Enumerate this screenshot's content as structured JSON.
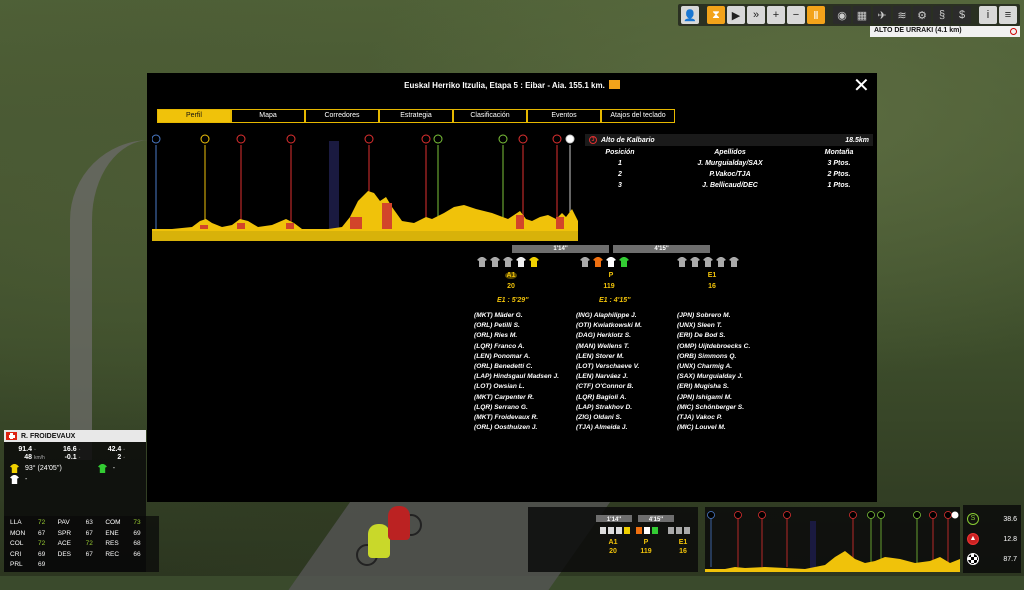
{
  "toolbar": {
    "buttons": [
      "person-icon",
      "hourglass-icon",
      "play-icon",
      "fast-forward-icon",
      "plus-icon",
      "minus-icon",
      "pause-icon",
      "eye-icon",
      "map-icon",
      "plane-icon",
      "radio-icon",
      "gear-icon",
      "strategy-icon",
      "dollar-icon",
      "info-icon",
      "menu-icon"
    ]
  },
  "climb_label": "ALTO DE URRAKI (4.1 km)",
  "modal": {
    "title": "Euskal Herriko Itzulia, Etapa 5 : Eibar - Aia. 155.1 km.",
    "tabs": [
      "Perfil",
      "Mapa",
      "Corredores",
      "Estrategia",
      "Clasificación",
      "Eventos",
      "Atajos del teclado"
    ],
    "active_tab": "Perfil"
  },
  "climb_panel": {
    "name": "Alto de Kalbario",
    "distance": "18.5km",
    "headers": [
      "Posición",
      "Apellidos",
      "Montaña"
    ],
    "rows": [
      [
        "1",
        "J. Murguialday/SAX",
        "3 Ptos."
      ],
      [
        "2",
        "P.Vakoc/TJA",
        "2 Ptos."
      ],
      [
        "3",
        "J. Bellicaud/DEC",
        "1 Ptos."
      ]
    ]
  },
  "groups": {
    "gaps": [
      "1'14''",
      "4'15''"
    ],
    "labels": [
      {
        "name": "A1",
        "count": "20"
      },
      {
        "name": "P",
        "count": "119"
      },
      {
        "name": "E1",
        "count": "16"
      }
    ],
    "times": [
      "E1 : 5'29''",
      "E1 : 4'15''"
    ]
  },
  "riders": {
    "col1": [
      "(MKT) Mäder G.",
      "(ORL) Petilli S.",
      "(ORL) Ries M.",
      "(LQR) Franco A.",
      "(LEN) Ponomar A.",
      "(ORL) Benedetti C.",
      "(LAP) Hindsgaul Madsen J.",
      "(LOT) Owsian L.",
      "(MKT) Carpenter R.",
      "(LQR) Serrano G.",
      "(MKT) Froidevaux R.",
      "(ORL) Oosthuizen J."
    ],
    "col2": [
      "(ING) Alaphilippe J.",
      "(OTI) Kwiatkowski M.",
      "(DAG) Herklotz S.",
      "(MAN) Wellens T.",
      "(LEN) Storer M.",
      "(LOT) Verschaeve V.",
      "(LEN) Narváez J.",
      "(CTF) O'Connor B.",
      "(LQR) Bagioli A.",
      "(LAP) Strakhov D.",
      "(ZIG) Oldani S.",
      "(TJA) Almeida J."
    ],
    "col3": [
      "(JPN) Sobrero M.",
      "(UNX) Sleen T.",
      "(ERI) De Bod S.",
      "(OMP) Uijtdebroecks C.",
      "(ORB) Simmons Q.",
      "(UNX) Charmig A.",
      "(SAX) Murguialday J.",
      "(ERI) Mugisha S.",
      "(JPN) Ishigami M.",
      "(MIC) Schönberger S.",
      "(TJA) Vakoc P.",
      "(MIC) Louvel M."
    ]
  },
  "rider_panel": {
    "name": "R. FROIDEVAUX",
    "stats": [
      {
        "value": "91.4",
        "unit": ""
      },
      {
        "value": "16.6",
        "unit": ""
      },
      {
        "value": "42.4",
        "unit": ""
      },
      {
        "value": "48",
        "unit": "km/h"
      },
      {
        "value": "-0.1",
        "unit": ""
      },
      {
        "value": "2",
        "unit": ""
      }
    ],
    "rows": [
      {
        "label": "93° (24'05'')",
        "extra": "-"
      },
      {
        "label": "-",
        "extra": ""
      }
    ]
  },
  "skills": [
    {
      "name": "LLA",
      "value": "72",
      "hi": true
    },
    {
      "name": "PAV",
      "value": "63",
      "hi": false
    },
    {
      "name": "COM",
      "value": "73",
      "hi": true
    },
    {
      "name": "MON",
      "value": "67",
      "hi": false
    },
    {
      "name": "SPR",
      "value": "67",
      "hi": false
    },
    {
      "name": "ENE",
      "value": "69",
      "hi": false
    },
    {
      "name": "COL",
      "value": "72",
      "hi": true
    },
    {
      "name": "ACE",
      "value": "72",
      "hi": true
    },
    {
      "name": "RES",
      "value": "68",
      "hi": false
    },
    {
      "name": "CRI",
      "value": "69",
      "hi": false
    },
    {
      "name": "DES",
      "value": "67",
      "hi": false
    },
    {
      "name": "REC",
      "value": "66",
      "hi": false
    },
    {
      "name": "PRL",
      "value": "69",
      "hi": false
    }
  ],
  "mini_groups": {
    "gaps": [
      "1'14''",
      "4'15''"
    ],
    "labels": [
      "A1",
      "P",
      "E1"
    ],
    "counts": [
      "20",
      "119",
      "16"
    ]
  },
  "right_stats": [
    "38.6",
    "12.8",
    "87.7"
  ],
  "colors": {
    "accent": "#f0c20a",
    "mountain": "#e03030",
    "sprint": "#7cc43a"
  }
}
